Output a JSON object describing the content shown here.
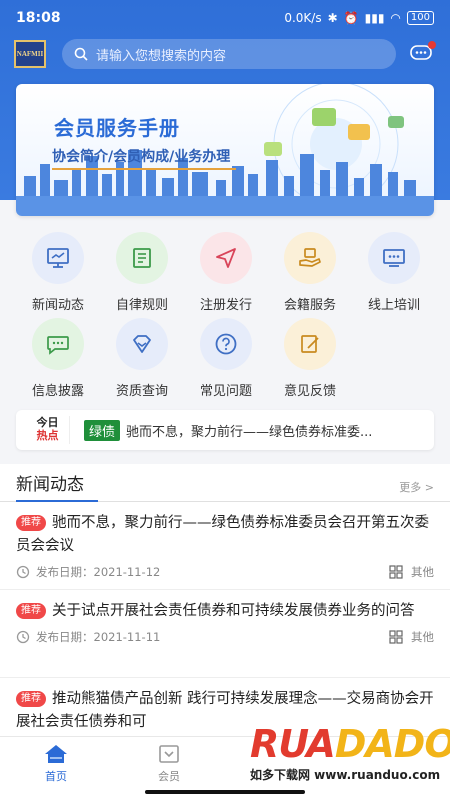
{
  "status": {
    "time": "18:08",
    "speed": "0.0K/s",
    "battery": "100"
  },
  "search": {
    "placeholder": "请输入您想搜索的内容"
  },
  "logo_text": "NAFMII",
  "banner": {
    "title": "会员服务手册",
    "subtitle": "协会简介/会员构成/业务办理"
  },
  "grid": [
    {
      "label": "新闻动态",
      "icon": "monitor-icon"
    },
    {
      "label": "自律规则",
      "icon": "rulebook-icon"
    },
    {
      "label": "注册发行",
      "icon": "send-icon"
    },
    {
      "label": "会籍服务",
      "icon": "hand-service-icon"
    },
    {
      "label": "线上培训",
      "icon": "training-icon"
    },
    {
      "label": "信息披露",
      "icon": "chat-icon"
    },
    {
      "label": "资质查询",
      "icon": "diamond-icon"
    },
    {
      "label": "常见问题",
      "icon": "question-icon"
    },
    {
      "label": "意见反馈",
      "icon": "edit-icon"
    }
  ],
  "ticker": {
    "logo_top": "今日",
    "logo_bottom": "热点",
    "tag": "绿债",
    "text": "驰而不息，聚力前行——绿色债券标准委..."
  },
  "news": {
    "heading": "新闻动态",
    "more": "更多 >",
    "items": [
      {
        "badge": "推荐",
        "title": "驰而不息，聚力前行——绿色债券标准委员会召开第五次委员会会议",
        "date": "发布日期：2021-11-12",
        "category": "其他"
      },
      {
        "badge": "推荐",
        "title": "关于试点开展社会责任债券和可持续发展债券业务的问答",
        "date": "发布日期：2021-11-11",
        "category": "其他"
      },
      {
        "badge": "推荐",
        "title": "推动熊猫债产品创新 践行可持续发展理念——交易商协会开展社会责任债券和可",
        "date": "",
        "category": ""
      }
    ]
  },
  "tabs": [
    {
      "label": "首页",
      "icon": "home-icon",
      "active": true
    },
    {
      "label": "会员",
      "icon": "member-icon",
      "active": false
    }
  ],
  "watermark": {
    "brand": "RUANDADO",
    "site": "如多下载网 www.ruanduo.com"
  },
  "colors": {
    "primary": "#2b6bd6",
    "badge": "#f04848",
    "green_tag": "#1f8f3a"
  }
}
